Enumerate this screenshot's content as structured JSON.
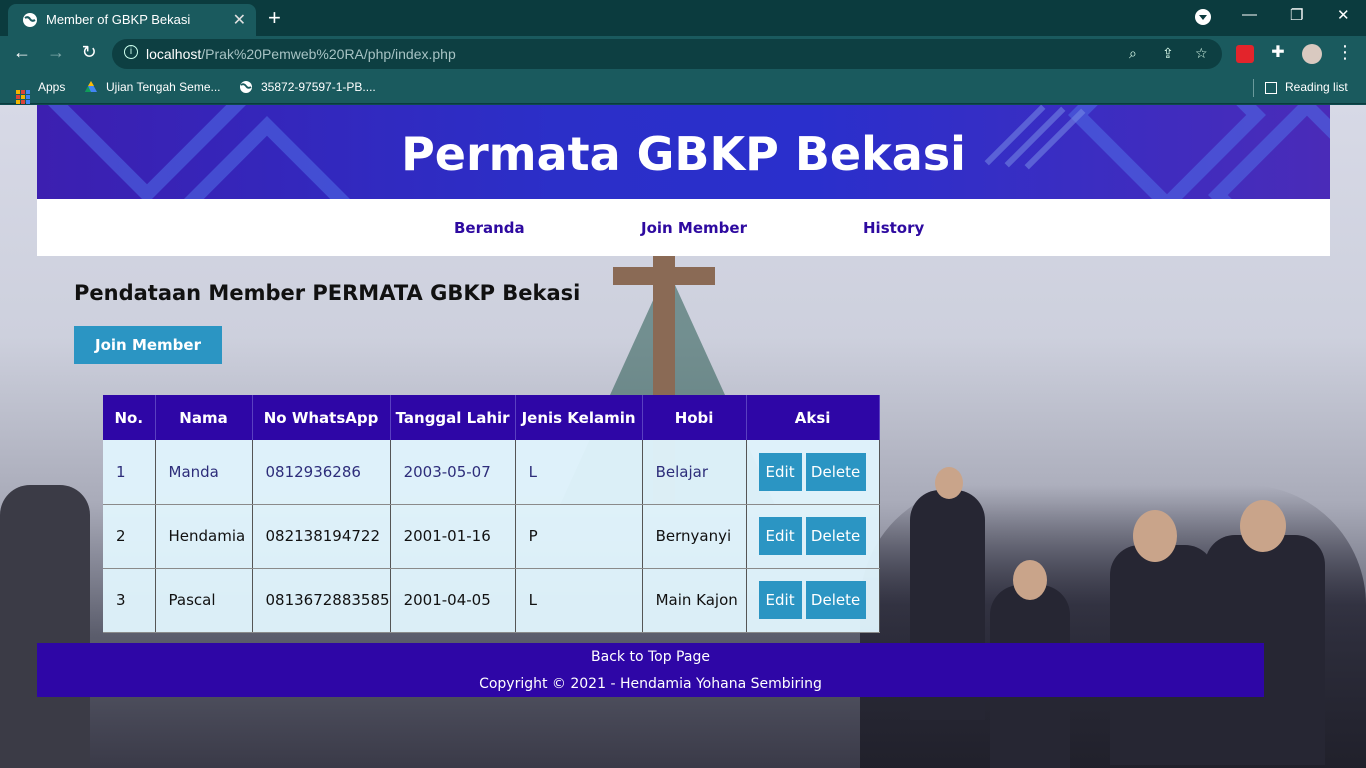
{
  "browser": {
    "tab_title": "Member of GBKP Bekasi",
    "url_host": "localhost",
    "url_path": "/Prak%20Pemweb%20RA/php/index.php",
    "bookmarks": [
      {
        "label": "Apps"
      },
      {
        "label": "Ujian Tengah Seme..."
      },
      {
        "label": "35872-97597-1-PB...."
      }
    ],
    "reading_list": "Reading list"
  },
  "site": {
    "title": "Permata GBKP Bekasi",
    "nav": [
      "Beranda",
      "Join Member",
      "History"
    ],
    "heading": "Pendataan Member PERMATA GBKP Bekasi",
    "join_button": "Join Member"
  },
  "table": {
    "headers": [
      "No.",
      "Nama",
      "No WhatsApp",
      "Tanggal Lahir",
      "Jenis Kelamin",
      "Hobi",
      "Aksi"
    ],
    "rows": [
      {
        "no": "1",
        "nama": "Manda",
        "wa": "0812936286",
        "lahir": "2003-05-07",
        "jk": "L",
        "hobi": "Belajar"
      },
      {
        "no": "2",
        "nama": "Hendamia",
        "wa": "082138194722",
        "lahir": "2001-01-16",
        "jk": "P",
        "hobi": "Bernyanyi"
      },
      {
        "no": "3",
        "nama": "Pascal",
        "wa": "0813672883585",
        "lahir": "2001-04-05",
        "jk": "L",
        "hobi": "Main Kajon"
      }
    ],
    "edit_label": "Edit",
    "delete_label": "Delete"
  },
  "footer": {
    "back_to_top": "Back to Top Page",
    "copyright": "Copyright © 2021 - Hendamia Yohana Sembiring"
  },
  "colors": {
    "primary": "#2e06a6",
    "button": "#2b95c3",
    "browser_chrome": "#1a5a5e"
  }
}
